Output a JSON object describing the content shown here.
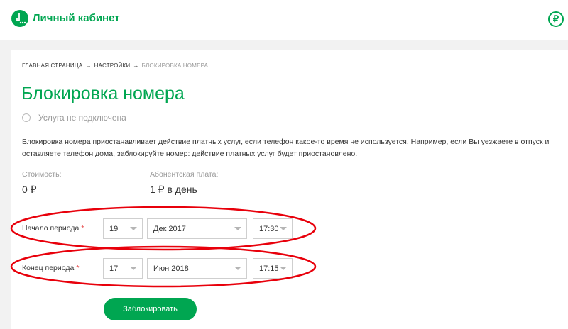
{
  "header": {
    "brand": "Личный кабинет",
    "balance_icon": "ruble-icon",
    "balance_symbol": "₽"
  },
  "breadcrumb": {
    "home": "ГЛАВНАЯ СТРАНИЦА",
    "settings": "НАСТРОЙКИ",
    "current": "БЛОКИРОВКА НОМЕРА",
    "separator": "→"
  },
  "page": {
    "title": "Блокировка номера",
    "status": "Услуга не подключена",
    "description": "Блокировка номера приостанавливает действие платных услуг, если телефон какое-то время не используется. Например, если Вы уезжаете в отпуск и оставляете телефон дома, заблокируйте номер: действие платных услуг будет приостановлено."
  },
  "pricing": {
    "cost_label": "Стоимость:",
    "cost_value": "0 ₽",
    "fee_label": "Абонентская плата:",
    "fee_value": "1 ₽ в день"
  },
  "form": {
    "required_mark": "*",
    "start": {
      "label": "Начало периода",
      "day": "19",
      "month": "Дек 2017",
      "time": "17:30"
    },
    "end": {
      "label": "Конец периода",
      "day": "17",
      "month": "Июн 2018",
      "time": "17:15"
    },
    "submit_label": "Заблокировать"
  },
  "colors": {
    "brand_green": "#00a651",
    "annotation_red": "#e8000b",
    "required_red": "#e64646"
  }
}
